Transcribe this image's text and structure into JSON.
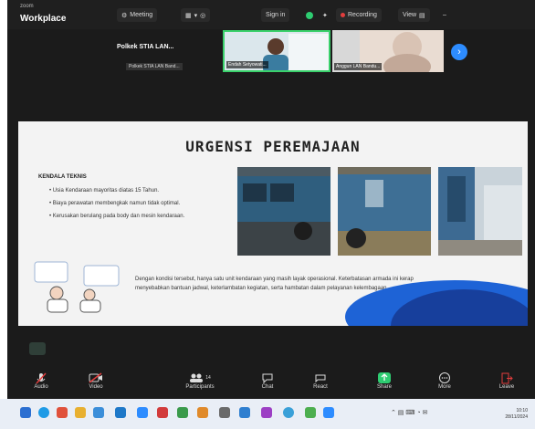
{
  "window": {
    "app_sub": "zoom",
    "app_name": "Workplace"
  },
  "topbar": {
    "meeting_label": "Meeting",
    "view_label": "View",
    "signin_label": "Sign in",
    "recording_label": "Recording",
    "colors": {
      "accent": "#2d8cff",
      "record": "#e23d3d",
      "shield": "#2ecc71"
    }
  },
  "participants": {
    "active_name": "Polkek STIA LAN...",
    "active_caption": "Polkek STIA LAN Band...",
    "tiles": [
      {
        "caption": "Endah Setyowati..."
      },
      {
        "caption": "Anggun LAN Bandu..."
      }
    ]
  },
  "slide": {
    "title": "URGENSI PEREMAJAAN",
    "section_heading": "KENDALA TEKNIS",
    "bullets": [
      "Usia Kendaraan mayoritas diatas 15 Tahun.",
      "Biaya perawatan membengkak namun tidak optimal.",
      "Kerusakan berulang pada body dan mesin kendaraan."
    ],
    "description": "Dengan kondisi tersebut, hanya satu unit kendaraan yang masih layak operasional. Keterbatasan armada ini kerap menyebabkan bantuan jadwal, keterlambatan kegiatan, serta hambatan dalam pelayanan kelembagaan."
  },
  "toolbar": {
    "items": [
      {
        "label": "Audio",
        "icon": "mic-muted-icon"
      },
      {
        "label": "Video",
        "icon": "video-off-icon"
      },
      {
        "label": "Participants",
        "icon": "participants-icon",
        "count": "14"
      },
      {
        "label": "Chat",
        "icon": "chat-icon"
      },
      {
        "label": "React",
        "icon": "react-icon"
      },
      {
        "label": "Share",
        "icon": "share-icon"
      },
      {
        "label": "More",
        "icon": "more-icon"
      },
      {
        "label": "Leave",
        "icon": "leave-icon"
      }
    ]
  },
  "taskbar": {
    "time": "10:10",
    "date": "28/11/2024"
  }
}
